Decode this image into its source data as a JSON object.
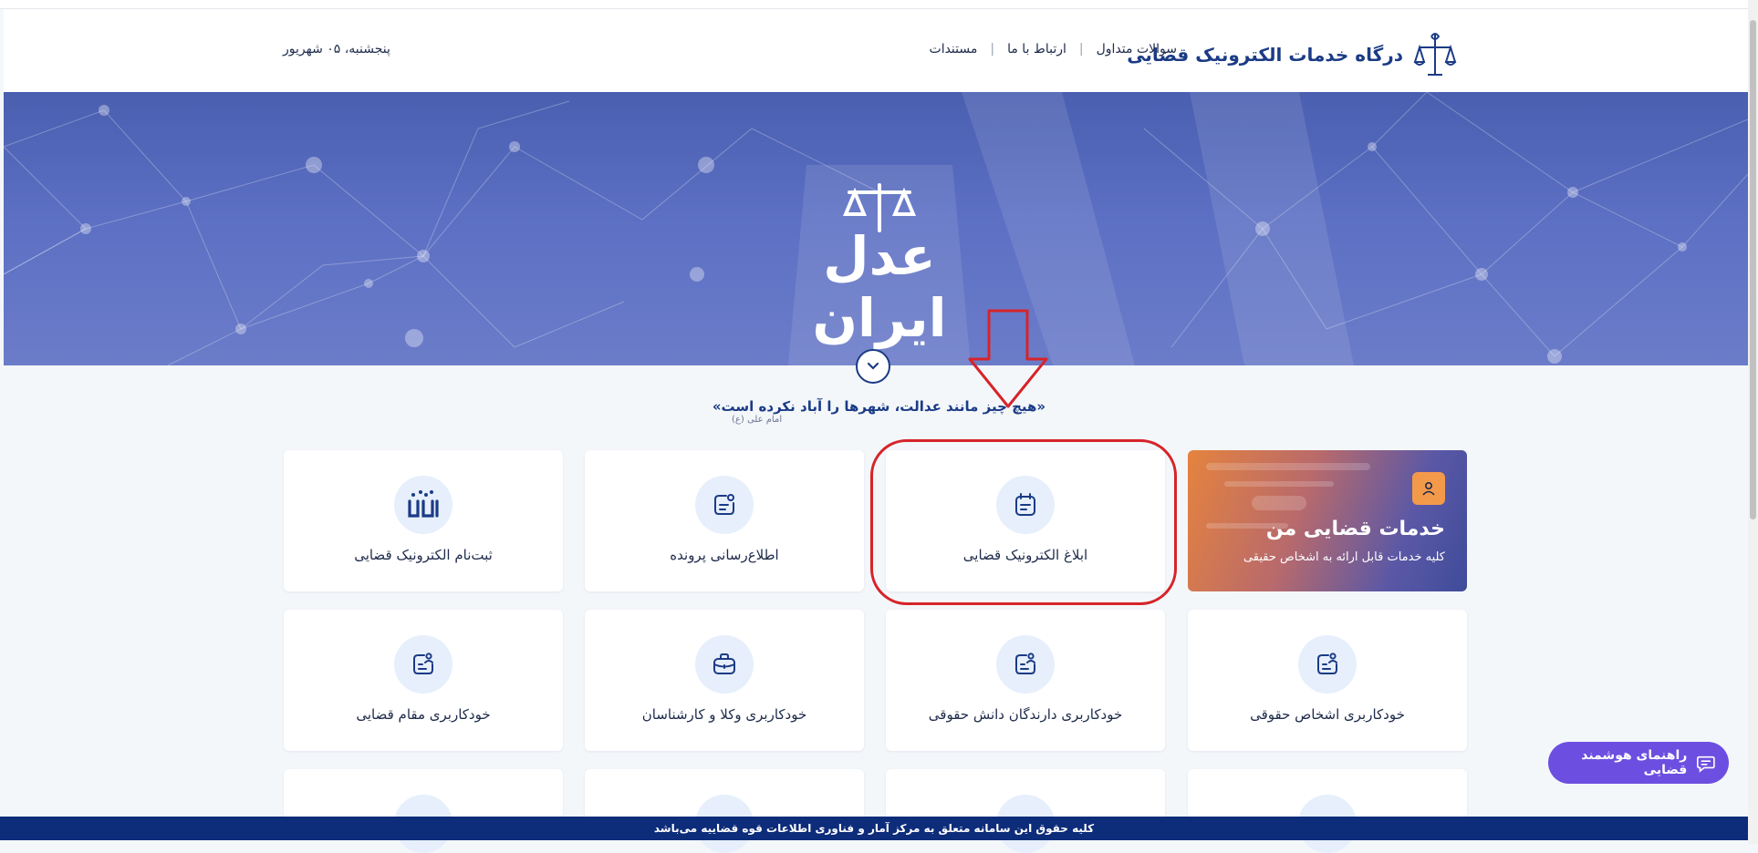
{
  "header": {
    "title": "درگاه خدمات الکترونیک قضایی",
    "nav": [
      "سوالات متداول",
      "ارتباط با ما",
      "مستندات"
    ],
    "date": "پنجشنبه، ۰۵ شهریور"
  },
  "hero": {
    "logo_text": "عدل ایران"
  },
  "quote": {
    "text": "«هیچ چیز مانند عدالت، شهرها را آباد نکرده است»",
    "author": "امام علی (ع)"
  },
  "feature": {
    "title": "خدمات قضایی من",
    "subtitle": "کلیه خدمات قابل ارائه به اشخاص حقیقی"
  },
  "cards": [
    {
      "label": "ابلاغ الکترونیک قضایی",
      "icon": "calendar-note-icon"
    },
    {
      "label": "اطلاع‌رسانی پرونده",
      "icon": "notification-doc-icon"
    },
    {
      "label": "ثبت‌نام الکترونیک قضایی",
      "icon": "registration-icon"
    },
    {
      "label": "خودکاربری اشخاص حقوقی",
      "icon": "user-doc-icon"
    },
    {
      "label": "خودکاربری دارندگان دانش حقوقی",
      "icon": "user-doc-icon"
    },
    {
      "label": "خودکاربری وکلا و کارشناسان",
      "icon": "briefcase-icon"
    },
    {
      "label": "خودکاربری مقام قضایی",
      "icon": "user-doc-icon"
    }
  ],
  "assistant": {
    "label": "راهنمای هوشمند قضایی"
  },
  "footer": {
    "text": "کلیه حقوق این سامانه متعلق به مرکز آمار و فناوری اطلاعات قوه قضاییه می‌باشد"
  },
  "colors": {
    "primary": "#1b3b86",
    "assistant": "#6c4fe0",
    "footer": "#0d2c7a",
    "annotation": "#d6242a"
  }
}
